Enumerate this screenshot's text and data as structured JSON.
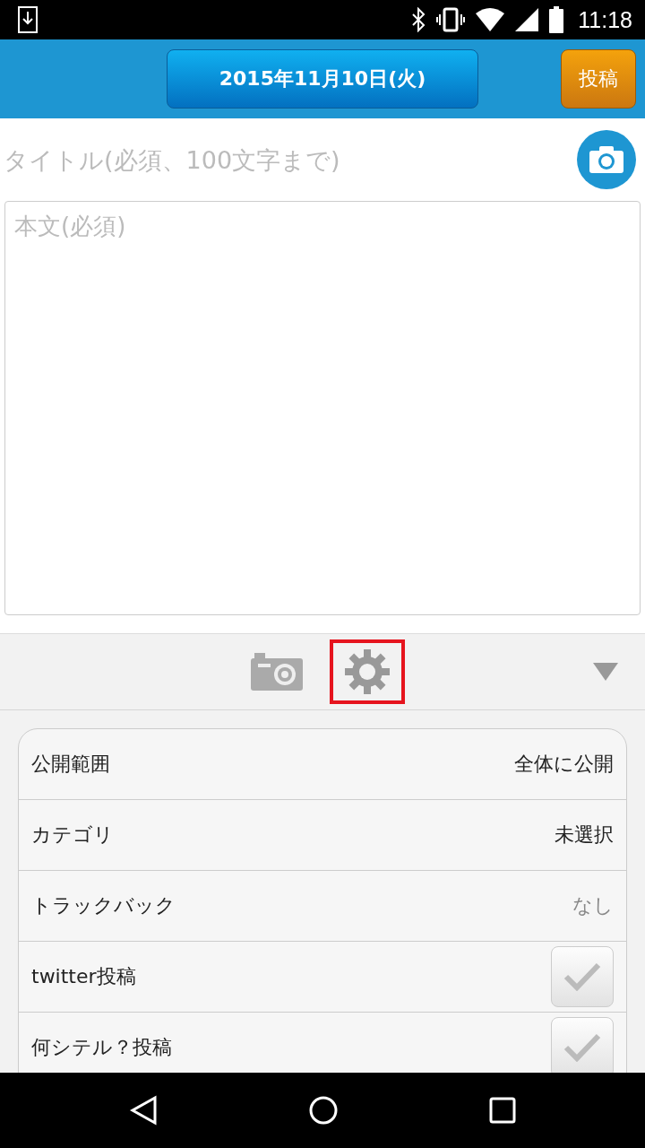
{
  "status_bar": {
    "time": "11:18"
  },
  "header": {
    "date_button": "2015年11月10日(火)",
    "post_button": "投稿"
  },
  "title_field": {
    "placeholder": "タイトル(必須、100文字まで)"
  },
  "body_field": {
    "placeholder": "本文(必須)"
  },
  "toolbar": {
    "tabs": [
      {
        "kind": "camera",
        "selected": false
      },
      {
        "kind": "settings",
        "selected": true
      }
    ],
    "expanded": true
  },
  "settings": [
    {
      "kind": "value",
      "label": "公開範囲",
      "value": "全体に公開",
      "dimmed": false
    },
    {
      "kind": "value",
      "label": "カテゴリ",
      "value": "未選択",
      "dimmed": false
    },
    {
      "kind": "value",
      "label": "トラックバック",
      "value": "なし",
      "dimmed": true
    },
    {
      "kind": "checkbox",
      "label": "twitter投稿",
      "checked": false
    },
    {
      "kind": "checkbox",
      "label": "何シテル？投稿",
      "checked": false
    }
  ]
}
